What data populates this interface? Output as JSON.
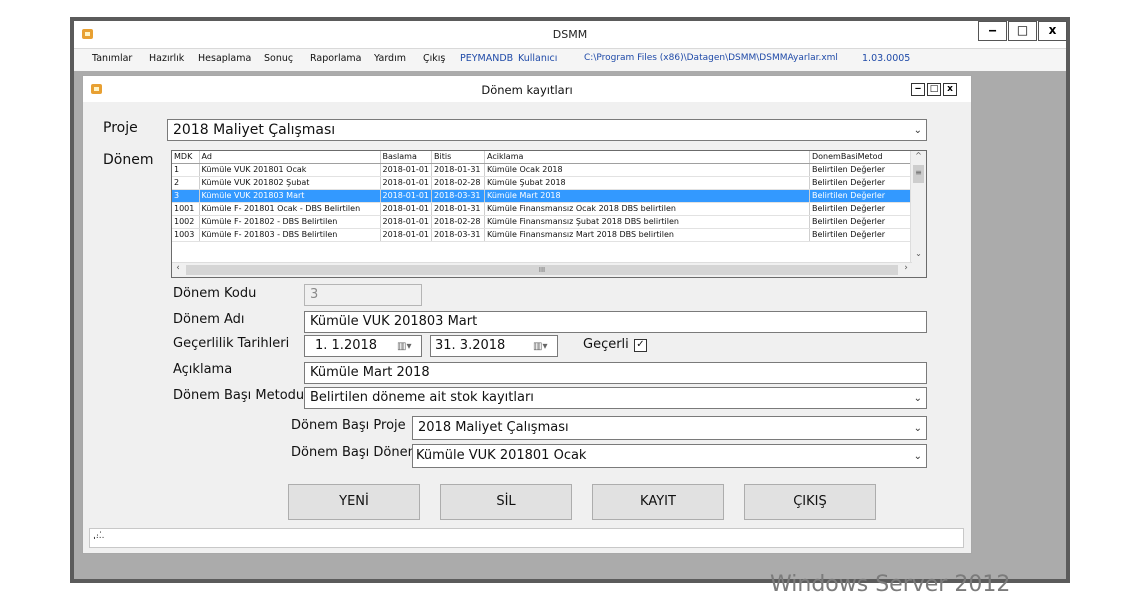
{
  "window": {
    "title": "DSMM",
    "minimize": "‒",
    "maximize": "□",
    "close": "x"
  },
  "menu": {
    "items": [
      "Tanımlar",
      "Hazırlık",
      "Hesaplama",
      "Sonuç",
      "Raporlama",
      "Yardım",
      "Çıkış",
      "PEYMANDB",
      "Kullanıcı",
      "C:\\Program Files (x86)\\Datagen\\DSMM\\DSMMAyarlar.xml",
      "1.03.0005"
    ]
  },
  "child": {
    "title": "Dönem kayıtları"
  },
  "form": {
    "proje_label": "Proje",
    "proje_value": "2018 Maliyet Çalışması",
    "donem_label": "Dönem",
    "donem_kodu_label": "Dönem Kodu",
    "donem_kodu_value": "3",
    "donem_adi_label": "Dönem Adı",
    "donem_adi_value": "Kümüle VUK 201803 Mart",
    "gecerlilik_label": "Geçerlilik Tarihleri",
    "date_start": "1. 1.2018",
    "date_end": "31. 3.2018",
    "gecerli_label": "Geçerli",
    "gecerli_checked": "✓",
    "aciklama_label": "Açıklama",
    "aciklama_value": "Kümüle Mart 2018",
    "metod_label": "Dönem Başı Metodu",
    "metod_value": "Belirtilen döneme ait stok kayıtları",
    "bas_proje_label": "Dönem Başı Proje",
    "bas_proje_value": "2018 Maliyet Çalışması",
    "bas_donem_label": "Dönem Başı Dönem",
    "bas_donem_value": "Kümüle VUK 201801 Ocak"
  },
  "grid": {
    "columns": [
      "MDK",
      "Ad",
      "Baslama",
      "Bitis",
      "Aciklama",
      "DonemBasiMetod"
    ],
    "rows": [
      [
        "1",
        "Kümüle VUK 201801 Ocak",
        "2018-01-01",
        "2018-01-31",
        "Kümüle Ocak 2018",
        "Belirtilen Değerler"
      ],
      [
        "2",
        "Kümüle VUK 201802 Şubat",
        "2018-01-01",
        "2018-02-28",
        "Kümüle Şubat 2018",
        "Belirtilen Değerler"
      ],
      [
        "3",
        "Kümüle VUK 201803 Mart",
        "2018-01-01",
        "2018-03-31",
        "Kümüle Mart 2018",
        "Belirtilen Değerler"
      ],
      [
        "1001",
        "Kümüle F- 201801 Ocak - DBS Belirtilen",
        "2018-01-01",
        "2018-01-31",
        "Kümüle Finansmansız Ocak 2018 DBS belirtilen",
        "Belirtilen Değerler"
      ],
      [
        "1002",
        "Kümüle F- 201802 - DBS Belirtilen",
        "2018-01-01",
        "2018-02-28",
        "Kümüle Finansmansız Şubat 2018 DBS belirtilen",
        "Belirtilen Değerler"
      ],
      [
        "1003",
        "Kümüle F- 201803 - DBS Belirtilen",
        "2018-01-01",
        "2018-03-31",
        "Kümüle Finansmansız Mart 2018 DBS belirtilen",
        "Belirtilen Değerler"
      ]
    ],
    "selected_row": 2
  },
  "buttons": {
    "yeni": "YENİ",
    "sil": "SİL",
    "kayit": "KAYIT",
    "cikis": "ÇIKIŞ"
  },
  "status": {
    "text": "...."
  },
  "watermark": "Windows Server 2012",
  "icons": {
    "app": "app-icon",
    "dropdown": "chevron-down-icon",
    "calendar": "calendar-icon",
    "check": "checkbox-icon"
  },
  "colors": {
    "selection": "#3399ff",
    "menu_link": "#1f4aa8"
  }
}
